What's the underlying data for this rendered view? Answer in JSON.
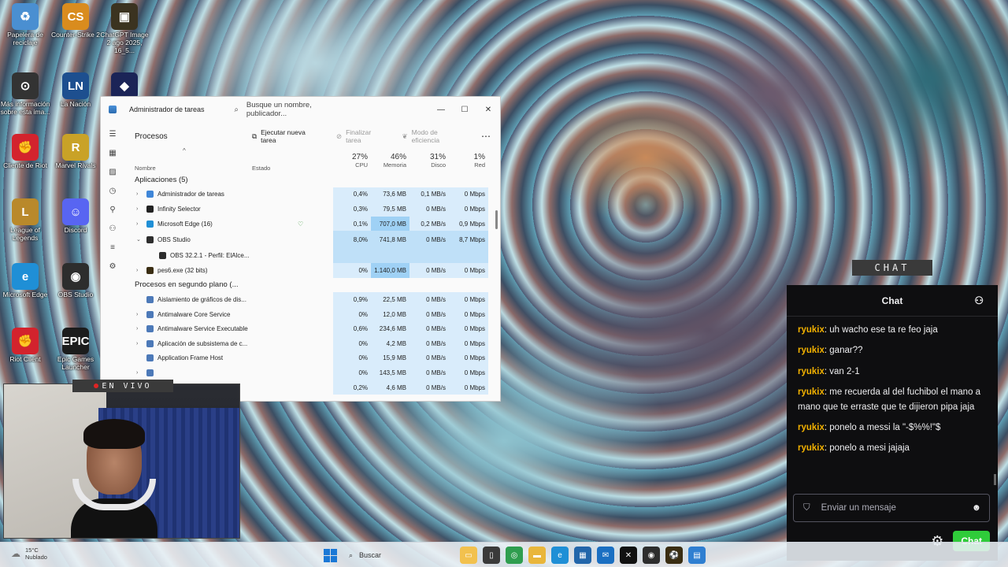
{
  "desktop": {
    "icons": [
      {
        "label": "Papelera de reciclaje",
        "color": "#4a8fd1",
        "glyph": "♻"
      },
      {
        "label": "Counter-Strike 2",
        "color": "#d98c1e",
        "glyph": "CS"
      },
      {
        "label": "ChatGPT Image 2 ago 2025, 16_5...",
        "color": "#3b3320",
        "glyph": "▣"
      },
      {
        "label": "Más información sobre esta ima...",
        "color": "#333333",
        "glyph": "⊙"
      },
      {
        "label": "La Nación",
        "color": "#1d4f8f",
        "glyph": "LN"
      },
      {
        "label": "",
        "color": "#1b2457",
        "glyph": "◆"
      },
      {
        "label": "Cliente de Riot",
        "color": "#d3232d",
        "glyph": "✊"
      },
      {
        "label": "Marvel Rivals",
        "color": "#c9a227",
        "glyph": "R"
      },
      {
        "label": "League of Legends",
        "color": "#b9892b",
        "glyph": "L"
      },
      {
        "label": "Discord",
        "color": "#5865f2",
        "glyph": "☺"
      },
      {
        "label": "Microsoft Edge",
        "color": "#1f8fd6",
        "glyph": "e"
      },
      {
        "label": "OBS Studio",
        "color": "#2d2d2d",
        "glyph": "◉"
      },
      {
        "label": "Riot Client",
        "color": "#d3232d",
        "glyph": "✊"
      },
      {
        "label": "Epic Games Launcher",
        "color": "#1c1c1c",
        "glyph": "EPIC"
      }
    ]
  },
  "taskmgr": {
    "title": "Administrador de tareas",
    "search_placeholder": "Busque un nombre, publicador...",
    "section": "Procesos",
    "run_task": "Ejecutar nueva tarea",
    "end_task": "Finalizar tarea",
    "efficiency": "Modo de eficiencia",
    "headers": {
      "name": "Nombre",
      "status": "Estado",
      "cpu_pct": "27%",
      "cpu": "CPU",
      "mem_pct": "46%",
      "mem": "Memoria",
      "disk_pct": "31%",
      "disk": "Disco",
      "net_pct": "1%",
      "net": "Red"
    },
    "rows": [
      {
        "type": "group",
        "name": "Aplicaciones (5)"
      },
      {
        "type": "proc",
        "name": "Administrador de tareas",
        "icon": "#3f86d8",
        "cpu": "0,4%",
        "mem": "73,6 MB",
        "disk": "0,1 MB/s",
        "net": "0 Mbps",
        "heat": "heat1"
      },
      {
        "type": "proc",
        "name": "Infinity Selector",
        "icon": "#222222",
        "cpu": "0,3%",
        "mem": "79,5 MB",
        "disk": "0 MB/s",
        "net": "0 Mbps",
        "heat": "heat1"
      },
      {
        "type": "proc",
        "name": "Microsoft Edge (16)",
        "icon": "#1f8fd6",
        "cpu": "0,1%",
        "mem": "707,0 MB",
        "disk": "0,2 MB/s",
        "net": "0,9 Mbps",
        "heat": "heat1",
        "memheat": "heat3",
        "status_icon": "♡"
      },
      {
        "type": "proc-open",
        "name": "OBS Studio",
        "icon": "#2d2d2d",
        "cpu": "8,0%",
        "mem": "741,8 MB",
        "disk": "0 MB/s",
        "net": "8,7 Mbps",
        "heat": "heat2",
        "tall": true
      },
      {
        "type": "child",
        "name": "OBS 32.2.1 - Perfil: ElAlce...",
        "icon": "#2d2d2d"
      },
      {
        "type": "proc",
        "name": "pes6.exe (32 bits)",
        "icon": "#3a2d12",
        "cpu": "0%",
        "mem": "1.140,0 MB",
        "disk": "0 MB/s",
        "net": "0 Mbps",
        "heat": "heat1",
        "memheat": "heat3"
      },
      {
        "type": "group",
        "name": "Procesos en segundo plano (..."
      },
      {
        "type": "proc-noexp",
        "name": "Aislamiento de gráficos de dis...",
        "icon": "#4c79b8",
        "cpu": "0,9%",
        "mem": "22,5 MB",
        "disk": "0 MB/s",
        "net": "0 Mbps",
        "heat": "heat1"
      },
      {
        "type": "proc",
        "name": "Antimalware Core Service",
        "icon": "#4c79b8",
        "cpu": "0%",
        "mem": "12,0 MB",
        "disk": "0 MB/s",
        "net": "0 Mbps",
        "heat": "heat1"
      },
      {
        "type": "proc",
        "name": "Antimalware Service Executable",
        "icon": "#4c79b8",
        "cpu": "0,6%",
        "mem": "234,6 MB",
        "disk": "0 MB/s",
        "net": "0 Mbps",
        "heat": "heat1"
      },
      {
        "type": "proc",
        "name": "Aplicación de subsistema de c...",
        "icon": "#4c79b8",
        "cpu": "0%",
        "mem": "4,2 MB",
        "disk": "0 MB/s",
        "net": "0 Mbps",
        "heat": "heat1"
      },
      {
        "type": "proc-noexp",
        "name": "Application Frame Host",
        "icon": "#4c79b8",
        "cpu": "0%",
        "mem": "15,9 MB",
        "disk": "0 MB/s",
        "net": "0 Mbps",
        "heat": "heat1"
      },
      {
        "type": "proc",
        "name": "",
        "icon": "#4c79b8",
        "cpu": "0%",
        "mem": "143,5 MB",
        "disk": "0 MB/s",
        "net": "0 Mbps",
        "heat": "heat1"
      },
      {
        "type": "proc",
        "name": "",
        "icon": "#4c79b8",
        "cpu": "0,2%",
        "mem": "4,6 MB",
        "disk": "0 MB/s",
        "net": "0 Mbps",
        "heat": "heat1"
      }
    ]
  },
  "stream": {
    "live_label": "EN VIVO",
    "chat_tag": "CHAT"
  },
  "chat": {
    "title": "Chat",
    "messages": [
      {
        "user": "ryukix",
        "text": "uh wacho ese ta re feo jaja"
      },
      {
        "user": "ryukix",
        "text": "ganar??"
      },
      {
        "user": "ryukix",
        "text": "van 2-1"
      },
      {
        "user": "ryukix",
        "text": "me recuerda al del fuchibol el mano a mano que te erraste que te dijieron pipa jaja"
      },
      {
        "user": "ryukix",
        "text": "ponelo a messi la \"-$%%!\"$"
      },
      {
        "user": "ryukix",
        "text": "ponelo a mesi jajaja"
      }
    ],
    "input_placeholder": "Enviar un mensaje",
    "send_label": "Chat"
  },
  "taskbar": {
    "temp": "15°C",
    "weather": "Nublado",
    "search_label": "Buscar",
    "apps": [
      {
        "name": "file-explorer-icon",
        "color": "#f2c14e",
        "glyph": "▭"
      },
      {
        "name": "terminal-icon",
        "color": "#3a3a3a",
        "glyph": "▯"
      },
      {
        "name": "chrome-icon",
        "color": "#2f9e4f",
        "glyph": "◎"
      },
      {
        "name": "folder-icon",
        "color": "#e9b63b",
        "glyph": "▬"
      },
      {
        "name": "edge-icon",
        "color": "#1f8fd6",
        "glyph": "e"
      },
      {
        "name": "store-icon",
        "color": "#2266aa",
        "glyph": "▦"
      },
      {
        "name": "outlook-icon",
        "color": "#1a6fc2",
        "glyph": "✉"
      },
      {
        "name": "capcut-icon",
        "color": "#111111",
        "glyph": "✕"
      },
      {
        "name": "obs-icon",
        "color": "#2d2d2d",
        "glyph": "◉"
      },
      {
        "name": "game-icon",
        "color": "#3a2d12",
        "glyph": "⚽"
      },
      {
        "name": "taskmgr-icon",
        "color": "#2f7fd1",
        "glyph": "▤"
      }
    ]
  }
}
